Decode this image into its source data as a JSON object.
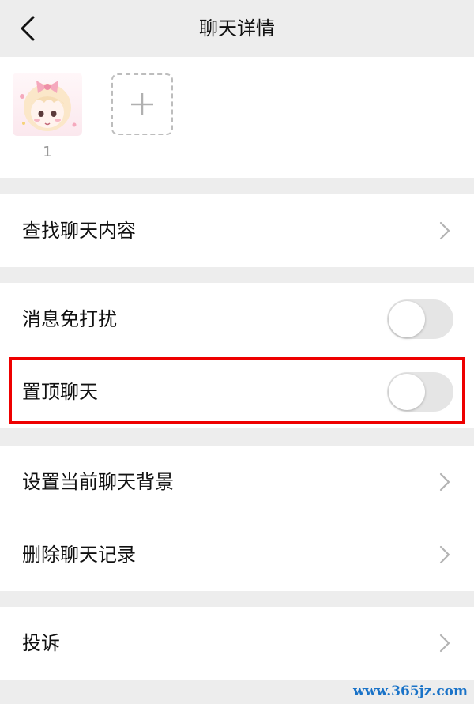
{
  "header": {
    "title": "聊天详情",
    "back_icon": "chevron-left-icon"
  },
  "members": {
    "items": [
      {
        "name": "1",
        "avatar": "anime-girl-avatar"
      }
    ],
    "add_icon": "plus-icon"
  },
  "sections": {
    "search": {
      "label": "查找聊天内容"
    },
    "mute": {
      "label": "消息免打扰",
      "enabled": false
    },
    "pin": {
      "label": "置顶聊天",
      "enabled": false,
      "highlighted": true
    },
    "background": {
      "label": "设置当前聊天背景"
    },
    "clear": {
      "label": "删除聊天记录"
    },
    "report": {
      "label": "投诉"
    }
  },
  "colors": {
    "page_bg": "#ededed",
    "card_bg": "#ffffff",
    "toggle_off": "#e5e5e5",
    "highlight": "#ee0000",
    "watermark": "#1a73c8"
  },
  "watermark": "www.365jz.com"
}
